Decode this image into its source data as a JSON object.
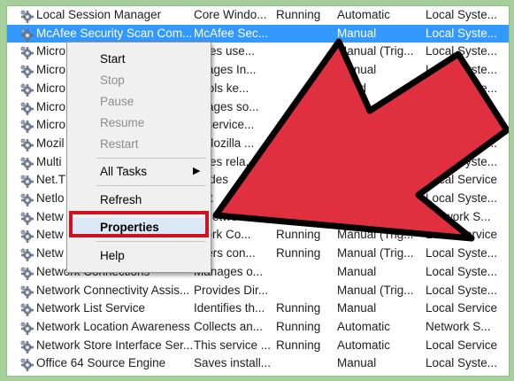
{
  "services": [
    {
      "name": "Local Session Manager",
      "desc": "Core Windo...",
      "status": "Running",
      "startup": "Automatic",
      "logon": "Local Syste..."
    },
    {
      "name": "McAfee Security Scan Com...",
      "desc": "McAfee Sec...",
      "status": "",
      "startup": "Manual",
      "logon": "Local Syste..."
    },
    {
      "name": "Micro",
      "desc": "ables use...",
      "status": "",
      "startup": "Manual (Trig...",
      "logon": "Local Syste..."
    },
    {
      "name": "Micro",
      "desc": "anages In...",
      "status": "",
      "startup": "Manual",
      "logon": "Local Syste..."
    },
    {
      "name": "Micro",
      "desc": "ntrols ke...",
      "status": "",
      "startup": "abled",
      "logon": "Local Syste..."
    },
    {
      "name": "Micro",
      "desc": "anages so...",
      "status": "",
      "startup": "ual",
      "logon": "Local Syste..."
    },
    {
      "name": "Micro",
      "desc": "st service...",
      "status": "",
      "startup": "",
      "logon": "etwork S..."
    },
    {
      "name": "Mozil",
      "desc": "e Mozilla ...",
      "status": "",
      "startup": "",
      "logon": "Local Syste..."
    },
    {
      "name": "Multi",
      "desc": "ables rela...",
      "status": "",
      "startup": "",
      "logon": "Local Syste..."
    },
    {
      "name": "Net.T",
      "desc": "ovides",
      "status": "",
      "startup": "",
      "logon": "Local Service"
    },
    {
      "name": "Netlo",
      "desc": "aint",
      "status": "",
      "startup": "",
      "logon": "Local Syste..."
    },
    {
      "name": "Netw",
      "desc": "e Netwo",
      "status": "",
      "startup": "",
      "logon": "Network S..."
    },
    {
      "name": "Netw",
      "desc": "twork Co...",
      "status": "Running",
      "startup": "Manual (Trig...",
      "logon": "Local Service"
    },
    {
      "name": "Netw",
      "desc": "okers con...",
      "status": "Running",
      "startup": "Manual (Trig...",
      "logon": "Local Syste..."
    },
    {
      "name": "Network Connections",
      "desc": "Manages o...",
      "status": "",
      "startup": "Manual",
      "logon": "Local Syste..."
    },
    {
      "name": "Network Connectivity Assis...",
      "desc": "Provides Dir...",
      "status": "",
      "startup": "Manual (Trig...",
      "logon": "Local Syste..."
    },
    {
      "name": "Network List Service",
      "desc": "Identifies th...",
      "status": "Running",
      "startup": "Manual",
      "logon": "Local Service"
    },
    {
      "name": "Network Location Awareness",
      "desc": "Collects an...",
      "status": "Running",
      "startup": "Automatic",
      "logon": "Network S..."
    },
    {
      "name": "Network Store Interface Ser...",
      "desc": "This service ...",
      "status": "Running",
      "startup": "Automatic",
      "logon": "Local Service"
    },
    {
      "name": "Office 64 Source Engine",
      "desc": "Saves install...",
      "status": "",
      "startup": "Manual",
      "logon": "Local Syste..."
    }
  ],
  "context_menu": {
    "start": "Start",
    "stop": "Stop",
    "pause": "Pause",
    "resume": "Resume",
    "restart": "Restart",
    "all_tasks": "All Tasks",
    "refresh": "Refresh",
    "properties": "Properties",
    "help": "Help"
  },
  "colors": {
    "selection": "#3399ff",
    "highlight_box": "#d0121e",
    "arrow_fill": "#e03040",
    "background": "#a7cf9c"
  },
  "icons": {
    "service": "gear-icon",
    "submenu": "chevron-right-icon",
    "pointer": "big-arrow-icon"
  }
}
